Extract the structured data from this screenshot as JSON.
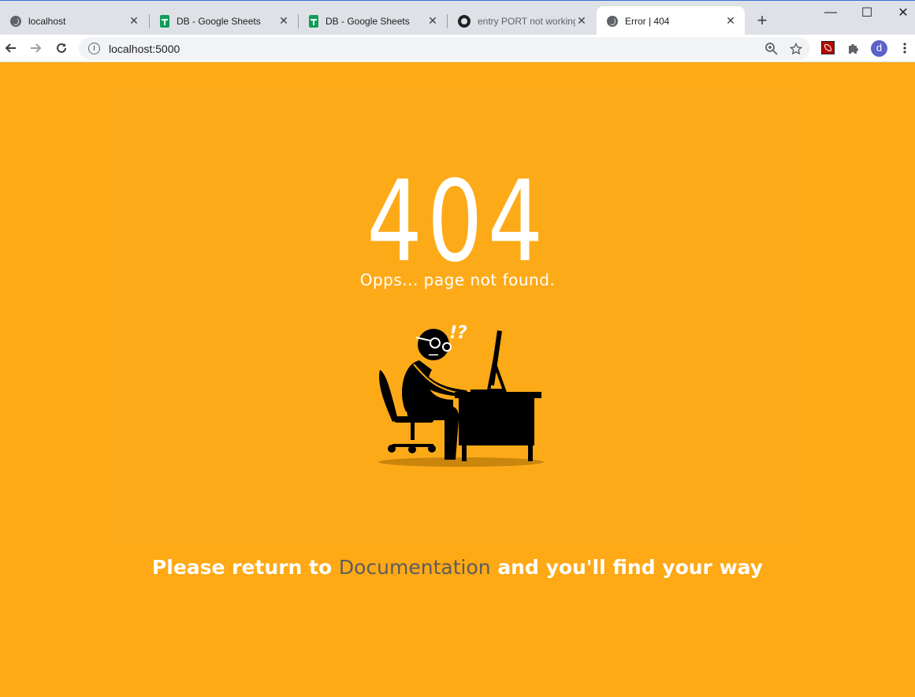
{
  "tabs": [
    {
      "title": "localhost",
      "favicon": "globe-icon"
    },
    {
      "title": "DB - Google Sheets",
      "favicon": "sheets-icon"
    },
    {
      "title": "DB - Google Sheets",
      "favicon": "sheets-icon"
    },
    {
      "title": "entry PORT not working",
      "favicon": "github-icon"
    },
    {
      "title": "Error | 404",
      "favicon": "globe-icon",
      "active": true
    }
  ],
  "tab_close_glyph": "✕",
  "new_tab_glyph": "+",
  "window_controls": {
    "minimize": "—",
    "maximize": "☐",
    "close": "✕"
  },
  "toolbar": {
    "url": "localhost:5000",
    "info_glyph": "i",
    "profile_initial": "d"
  },
  "page": {
    "code": "404",
    "subtitle": "Opps... page not found.",
    "bangs": "!?",
    "message_before": "Please return to ",
    "link_text": "Documentation",
    "message_after": " and you'll find your way"
  },
  "colors": {
    "background": "#fea915",
    "panel": "#fdaa18",
    "text": "#ffffff",
    "link": "#5c5c5c",
    "tabstrip": "#dee1e6"
  }
}
